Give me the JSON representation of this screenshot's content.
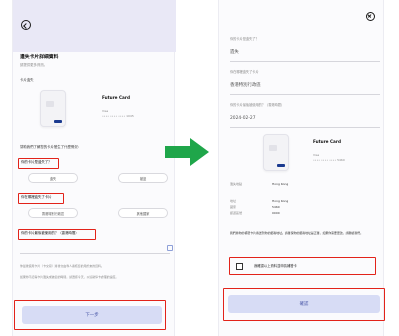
{
  "left_panel": {
    "title": "遺失卡片詳細資料",
    "subtitle": "請提供更多資訊。",
    "card_section_label": "卡片遺失",
    "card_name": "Future Card",
    "card_brand": "Visa",
    "card_number_masked": "•••• •••• •••• 1045",
    "question_intro": "幫助我們了解您的卡片發生了什麼情況：",
    "q1_label": "你的卡片是遺失了？",
    "q1_options": [
      "遺失",
      "被盜"
    ],
    "q2_label": "你在哪裡遺失了卡片",
    "q2_options": [
      "香港特別行政區",
      "其他國家"
    ],
    "q3_label": "你的卡片最後被使用的？（香港時間）",
    "note_line1": "你最後使用卡片（卡交易）將會交由專人審核您的用於來的資料。",
    "note_line2": "如果你不記得卡片遺失或被盜的時間，請選擇今天，以協助停卡處理的速度。",
    "next_button": "下一步"
  },
  "right_panel": {
    "f1_label": "你的卡片是遺失了？",
    "f1_value": "遺失",
    "f2_label": "你在哪裡遺失了卡片",
    "f2_value": "香港特別行政區",
    "f3_label": "你的卡片最後被使用的？（香港時間）",
    "f3_value": "2024-02-27",
    "card_name": "Future Card",
    "card_brand": "Visa",
    "card_number_masked": "•••• •••• •••• 5460",
    "details": [
      {
        "label": "遺失地點",
        "value": "Hong Kong"
      },
      {
        "label": "地址",
        "value": "Hong Kong"
      },
      {
        "label": "國家",
        "value": "5460"
      },
      {
        "label": "郵遞區號",
        "value": "0000"
      }
    ],
    "replacement_note": "我們將你的補發卡片寄送到你的郵寄地址。請確保你的郵寄地址是正確，如果你需要更改，請聯絡我們。",
    "checkbox_label": "我確認以上資料並申請補發卡",
    "confirm_button": "確認"
  },
  "colors": {
    "highlight_red": "#e2231a",
    "arrow_green": "#1fa64a",
    "button_bg": "#d7dcf5",
    "header_bg": "#e9e8f6"
  }
}
